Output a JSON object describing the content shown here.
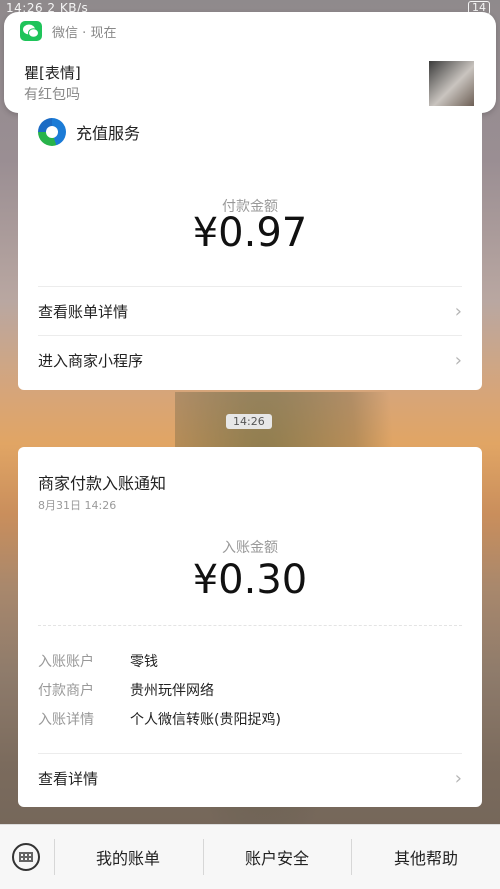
{
  "status_bar": {
    "time": "14:26",
    "network_speed": "2 KB/s",
    "battery": "14"
  },
  "notification": {
    "app_name": "微信",
    "time": "现在",
    "separator": "·",
    "title": "瞿[表情]",
    "body": "有红包吗"
  },
  "card1": {
    "brand_name": "充值服务",
    "amount_label": "付款金额",
    "amount": "¥0.97",
    "links": [
      {
        "label": "查看账单详情",
        "chevron": "›"
      },
      {
        "label": "进入商家小程序",
        "chevron": "›"
      }
    ]
  },
  "time_pill": "14:26",
  "card2": {
    "title": "商家付款入账通知",
    "date": "8月31日  14:26",
    "amount_label": "入账金额",
    "amount": "¥0.30",
    "details": [
      {
        "key": "入账账户",
        "value": "零钱"
      },
      {
        "key": "付款商户",
        "value": "贵州玩伴网络"
      },
      {
        "key": "入账详情",
        "value": "个人微信转账(贵阳捉鸡)"
      }
    ],
    "view_details": {
      "label": "查看详情",
      "chevron": "›"
    }
  },
  "bottom_nav": {
    "items": [
      "我的账单",
      "账户安全",
      "其他帮助"
    ]
  },
  "colors": {
    "wechat_green": "#1fc45a",
    "card_bg": "#ffffff",
    "muted_text": "#999999"
  },
  "icons": [
    "wechat-icon",
    "avatar-image",
    "service-logo-icon",
    "chevron-right-icon",
    "keyboard-icon"
  ]
}
